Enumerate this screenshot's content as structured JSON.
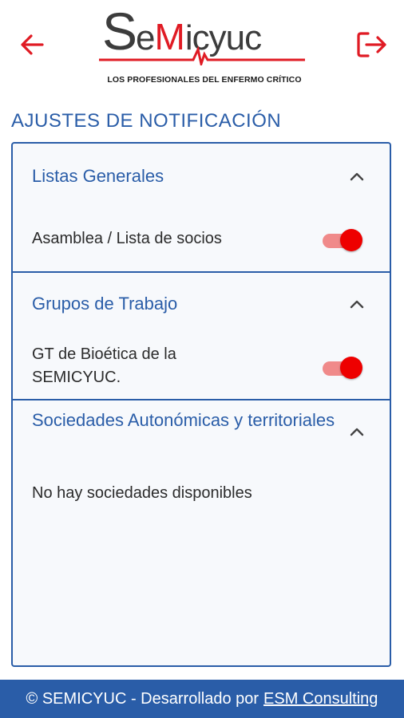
{
  "header": {
    "back_icon": "arrow-left-icon",
    "logout_icon": "logout-icon",
    "logo": {
      "wordmark": "SeMicyuc",
      "tagline": "LOS PROFESIONALES DEL ENFERMO CRÍTICO"
    }
  },
  "page": {
    "title": "AJUSTES DE NOTIFICACIÓN"
  },
  "sections": [
    {
      "title": "Listas Generales",
      "expanded": true,
      "items": [
        {
          "label": "Asamblea / Lista de socios",
          "enabled": true
        }
      ]
    },
    {
      "title": "Grupos de Trabajo",
      "expanded": true,
      "items": [
        {
          "label": "GT de Bioética de la SEMICYUC.",
          "enabled": true
        }
      ]
    },
    {
      "title": "Sociedades Autonómicas y territoriales",
      "expanded": true,
      "empty_text": "No hay sociedades disponibles"
    }
  ],
  "footer": {
    "text": "© SEMICYUC - Desarrollado por",
    "link": "ESM Consulting"
  },
  "colors": {
    "accent": "#2a5da8",
    "brand_red": "#e01b24",
    "toggle_on": "#ee0000"
  }
}
